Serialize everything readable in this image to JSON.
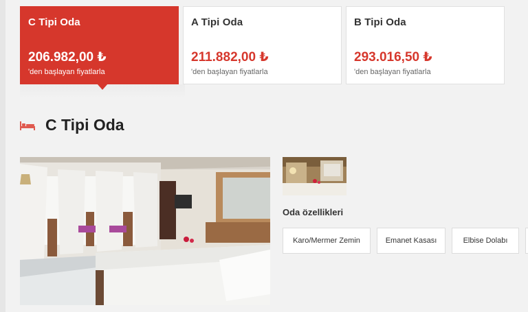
{
  "room_tabs": [
    {
      "name": "C Tipi Oda",
      "price": "206.982,00 ₺",
      "note": "'den başlayan fiyatlarla",
      "active": true
    },
    {
      "name": "A Tipi Oda",
      "price": "211.882,00 ₺",
      "note": "'den başlayan fiyatlarla",
      "active": false
    },
    {
      "name": "B Tipi Oda",
      "price": "293.016,50 ₺",
      "note": "'den başlayan fiyatlarla",
      "active": false
    }
  ],
  "section": {
    "title": "C Tipi Oda",
    "icon": "bed-icon"
  },
  "features": {
    "label": "Oda özellikleri",
    "items": [
      "Karo/Mermer Zemin",
      "Emanet Kasası",
      "Elbise Dolabı"
    ]
  },
  "colors": {
    "accent": "#d6372c",
    "background": "#f2f2f2"
  }
}
